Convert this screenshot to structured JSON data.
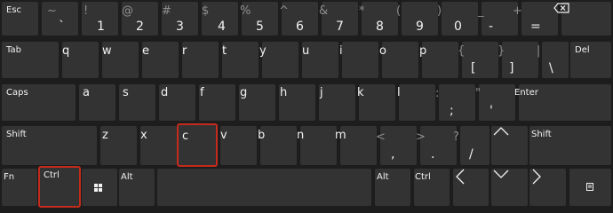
{
  "keyboard": {
    "colors": {
      "background": "#1d1d1d",
      "key": "#333333",
      "text": "#f2f2f2",
      "dim": "#8e8e8e",
      "highlight": "#c42b1c"
    },
    "highlighted_keys": [
      "c",
      "ctrl"
    ],
    "row1": {
      "esc": "Esc",
      "grave": {
        "shift": "~",
        "main": "`"
      },
      "k1": {
        "shift": "!",
        "main": "1"
      },
      "k2": {
        "shift": "@",
        "main": "2"
      },
      "k3": {
        "shift": "#",
        "main": "3"
      },
      "k4": {
        "shift": "$",
        "main": "4"
      },
      "k5": {
        "shift": "%",
        "main": "5"
      },
      "k6": {
        "shift": "^",
        "main": "6"
      },
      "k7": {
        "shift": "&",
        "main": "7"
      },
      "k8": {
        "shift": "*",
        "main": "8"
      },
      "k9": {
        "shift": "(",
        "main": "9"
      },
      "k0": {
        "shift": ")",
        "main": "0"
      },
      "minus": {
        "shift": "_",
        "main": "-"
      },
      "equal": {
        "shift": "+",
        "main": "="
      },
      "backspace_icon": "backspace-icon"
    },
    "row2": {
      "tab": "Tab",
      "letters": [
        "q",
        "w",
        "e",
        "r",
        "t",
        "y",
        "u",
        "i",
        "o",
        "p"
      ],
      "lbracket": {
        "shift": "{",
        "main": "["
      },
      "rbracket": {
        "shift": "}",
        "main": "]"
      },
      "backslash": {
        "shift": "|",
        "main": "\\"
      },
      "del": "Del"
    },
    "row3": {
      "caps": "Caps",
      "letters": [
        "a",
        "s",
        "d",
        "f",
        "g",
        "h",
        "j",
        "k",
        "l"
      ],
      "semicolon": {
        "shift": ":",
        "main": ";"
      },
      "quote": {
        "shift": "\"",
        "main": "'"
      },
      "enter": "Enter"
    },
    "row4": {
      "shift_left": "Shift",
      "letters": [
        "z",
        "x",
        "c",
        "v",
        "b",
        "n",
        "m"
      ],
      "comma": {
        "shift": "<",
        "main": ","
      },
      "period": {
        "shift": ">",
        "main": "."
      },
      "slash": {
        "shift": "?",
        "main": "/"
      },
      "up_icon": "chevron-up-icon",
      "shift_right": "Shift"
    },
    "row5": {
      "fn": "Fn",
      "ctrl_left": "Ctrl",
      "win_icon": "windows-icon",
      "alt_left": "Alt",
      "alt_right": "Alt",
      "ctrl_right": "Ctrl",
      "left_icon": "chevron-left-icon",
      "down_icon": "chevron-down-icon",
      "right_icon": "chevron-right-icon",
      "menu_icon": "context-menu-icon"
    }
  }
}
